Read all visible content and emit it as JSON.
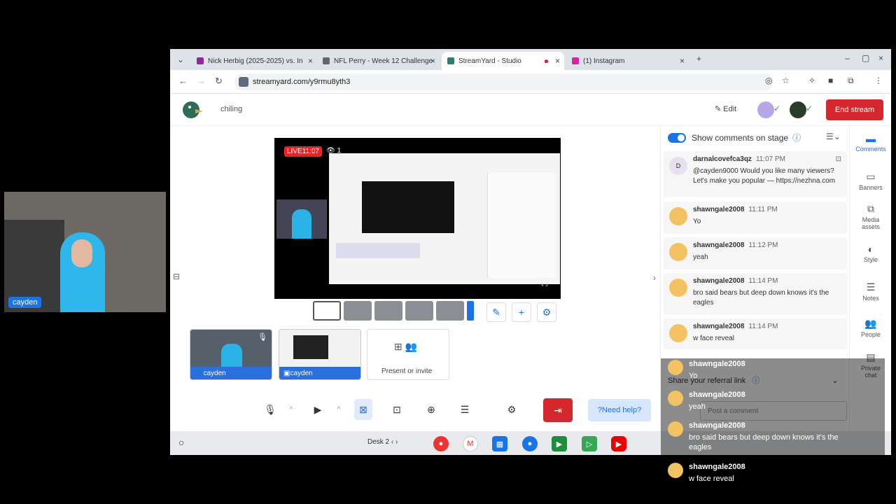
{
  "tabs": [
    {
      "label": "Nick Herbig (2025-2025) vs. In"
    },
    {
      "label": "NFL Perry - Week 12 Challenge"
    },
    {
      "label": "StreamYard - Studio"
    },
    {
      "label": "(1) Instagram"
    }
  ],
  "url": "streamyard.com/y9rmu8yth3",
  "header": {
    "broadcast_title": "chiling",
    "edit_label": "Edit",
    "end_stream_label": "End stream"
  },
  "stage": {
    "live_label": "LIVE",
    "live_time": "11:07",
    "viewer_count": "1"
  },
  "sources": [
    {
      "name": "cayden"
    },
    {
      "name": "cayden"
    }
  ],
  "present_label": "Present or invite",
  "help_label": "Need help?",
  "comments_panel": {
    "show_label": "Show comments on stage",
    "referral_label": "Share your referral link",
    "post_placeholder": "Post a comment"
  },
  "comments": [
    {
      "initial": "D",
      "author": "darnalcovefca3qz",
      "time": "11:07 PM",
      "text": "@cayden9000 Would you like many viewers? Let's make you popular — https://nezhna.com"
    },
    {
      "initial": "",
      "author": "shawngale2008",
      "time": "11:11 PM",
      "text": "Yo"
    },
    {
      "initial": "",
      "author": "shawngale2008",
      "time": "11:12 PM",
      "text": "yeah"
    },
    {
      "initial": "",
      "author": "shawngale2008",
      "time": "11:14 PM",
      "text": "bro said bears but deep down knows it's the eagles"
    },
    {
      "initial": "",
      "author": "shawngale2008",
      "time": "11:14 PM",
      "text": "w face reveal"
    }
  ],
  "rail": [
    {
      "label": "Comments"
    },
    {
      "label": "Banners"
    },
    {
      "label": "Media assets"
    },
    {
      "label": "Style"
    },
    {
      "label": "Notes"
    },
    {
      "label": "People"
    },
    {
      "label": "Private chat"
    }
  ],
  "taskbar": {
    "desk_label": "Desk 2"
  },
  "webcam": {
    "name": "cayden"
  },
  "overlay_chat": [
    {
      "author": "shawngale2008",
      "text": "Yo"
    },
    {
      "author": "shawngale2008",
      "text": "yeah"
    },
    {
      "author": "shawngale2008",
      "text": "bro said bears but deep down knows it's the eagles"
    },
    {
      "author": "shawngale2008",
      "text": "w face reveal"
    }
  ],
  "colors": {
    "accent": "#1a73e8",
    "danger": "#d4282e",
    "avatar": "#f3c262"
  }
}
